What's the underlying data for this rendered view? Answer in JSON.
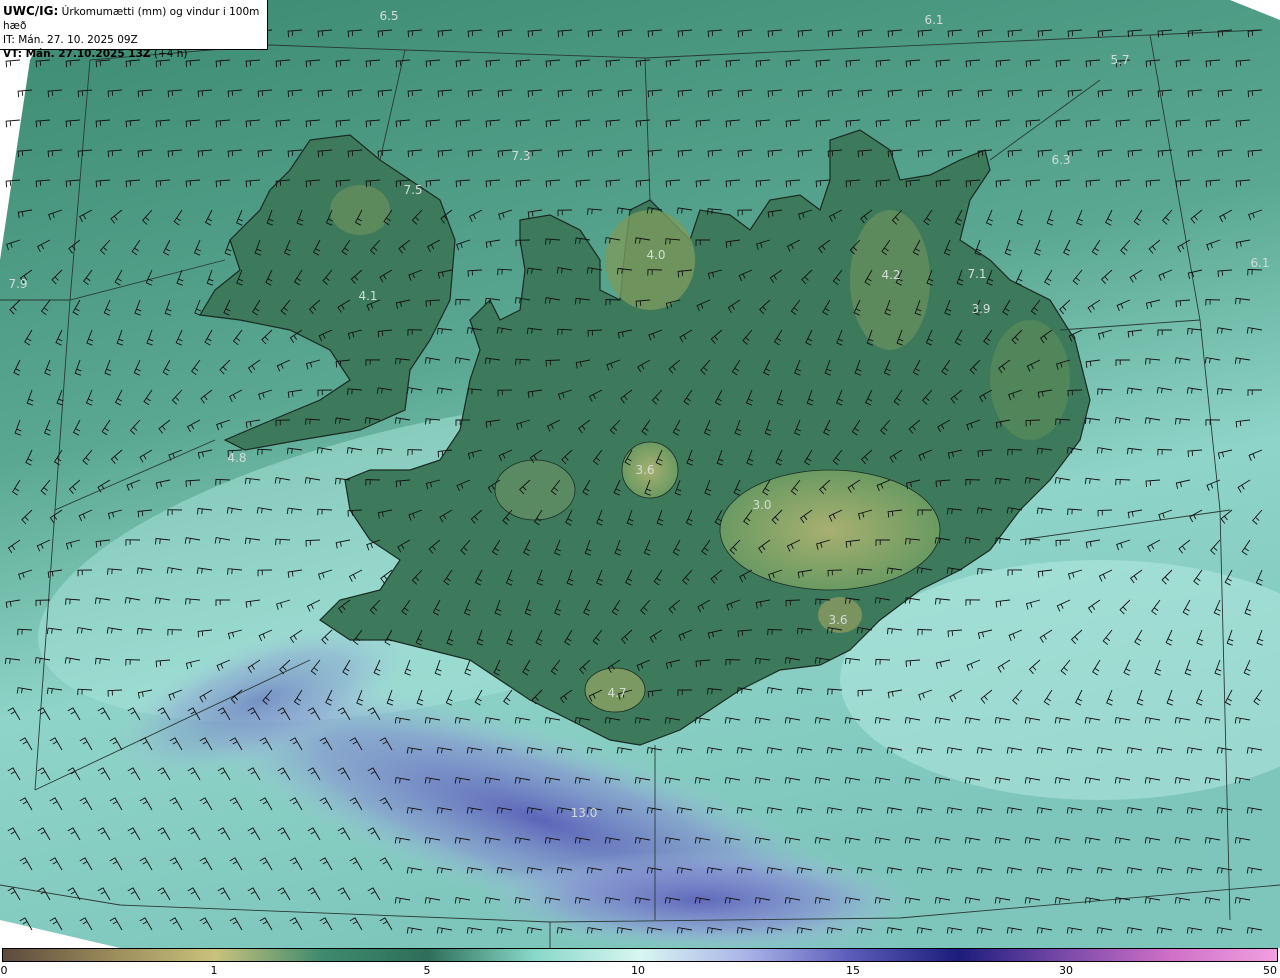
{
  "header": {
    "line1_bold": "UWC/IG:",
    "line1_rest": " Úrkomumætti (mm) og vindur i 100m hæð",
    "line2": "IT: Mán. 27. 10. 2025 09Z",
    "line3_bold": "VT: Mán. 27.10.2025 13Z",
    "line3_rest": " (+4 h)"
  },
  "map_labels": [
    "6.5",
    "6.1",
    "5.7",
    "7.3",
    "6.3",
    "7.5",
    "4.0",
    "4.2",
    "7.1",
    "6.1",
    "7.9",
    "4.1",
    "3.9",
    "4.8",
    "3.6",
    "3.0",
    "3.6",
    "4.7",
    "13.0"
  ],
  "colorbar": {
    "ticks": [
      "0",
      "1",
      "5",
      "10",
      "15",
      "30",
      "50"
    ],
    "colors": [
      "#5c4a3c",
      "#9a8a5a",
      "#c9c27c",
      "#3f8a6e",
      "#2e6e5a",
      "#88d8c8",
      "#d8f6f2",
      "#aab4e8",
      "#5a5ab8",
      "#1c1c7c",
      "#7a4aa8",
      "#d070c8",
      "#f0a0e0"
    ]
  },
  "palette": {
    "sea": "#4a9a86",
    "land": "#3f7a5f",
    "highland": "#8aa060",
    "precip_light": "#9edcd0",
    "precip_heavy": "#6a72c0"
  }
}
